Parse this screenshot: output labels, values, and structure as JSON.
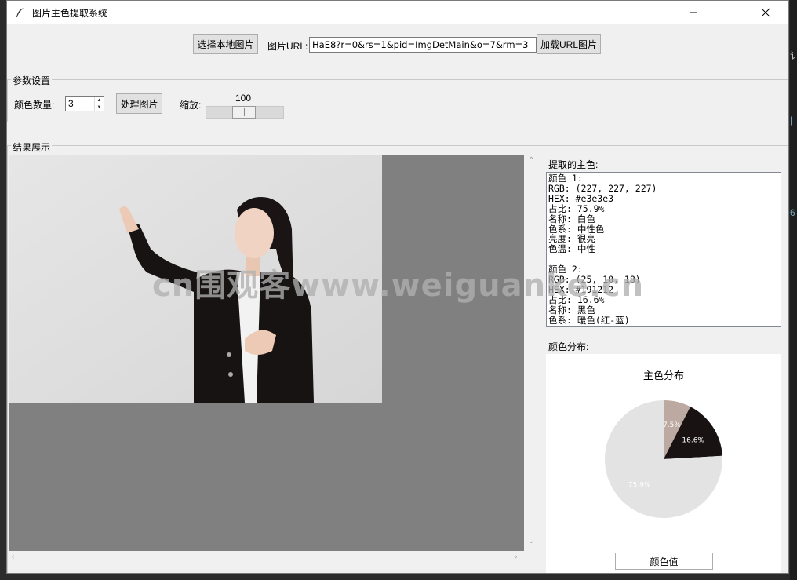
{
  "window": {
    "title": "图片主色提取系统",
    "controls": {
      "minimize": "minimize-icon",
      "maximize": "maximize-icon",
      "close": "close-icon"
    }
  },
  "toolbar": {
    "select_local_label": "选择本地图片",
    "url_label": "图片URL:",
    "url_value": "HaE8?r=0&rs=1&pid=ImgDetMain&o=7&rm=3",
    "load_url_label": "加载URL图片"
  },
  "params": {
    "group_title": "参数设置",
    "color_count_label": "颜色数量:",
    "color_count_value": "3",
    "process_label": "处理图片",
    "zoom_label": "缩放:",
    "zoom_value": "100",
    "zoom_fraction": 0.5
  },
  "results": {
    "group_title": "结果展示",
    "extracted_label": "提取的主色:",
    "colors_text": "颜色 1:\nRGB: (227, 227, 227)\nHEX: #e3e3e3\n占比: 75.9%\n名称: 白色\n色系: 中性色\n亮度: 很亮\n色温: 中性\n\n颜色 2:\nRGB: (25, 18, 18)\nHEX: #191212\n占比: 16.6%\n名称: 黑色\n色系: 暖色(红-蓝)",
    "distribution_label": "颜色分布:",
    "color_value_button": "颜色值"
  },
  "chart_data": {
    "type": "pie",
    "title": "主色分布",
    "slices": [
      {
        "label": "75.9%",
        "value": 75.9,
        "color": "#e3e3e3"
      },
      {
        "label": "16.6%",
        "value": 16.6,
        "color": "#191212"
      },
      {
        "label": "7.5%",
        "value": 7.5,
        "color": "#bca9a1"
      }
    ]
  },
  "watermark": "cn围观客www.weiguanke.cn",
  "colors": {
    "canvas_bg": "#808080",
    "window_bg": "#f0f0f0"
  }
}
